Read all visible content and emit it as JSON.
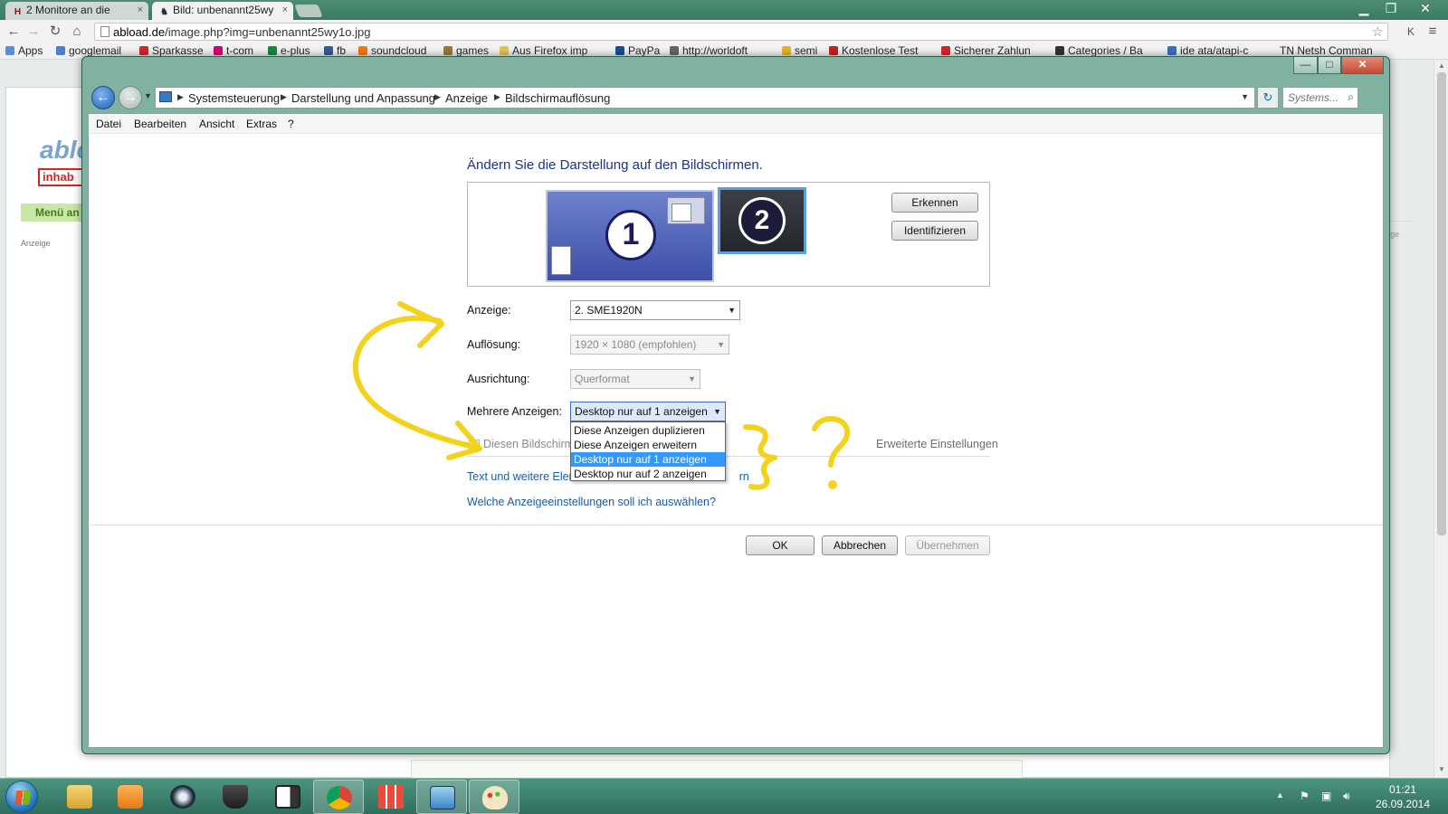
{
  "browser": {
    "tabs": [
      {
        "label": "2 Monitore an die"
      },
      {
        "label": "Bild: unbenannt25wy"
      }
    ],
    "url_domain": "abload.de",
    "url_path": "/image.php?img=unbenannt25wy1o.jpg",
    "bookmarks": [
      "Apps",
      "googlemail",
      "Sparkasse",
      "t-com",
      "e-plus",
      "fb",
      "soundcloud",
      "games",
      "Aus Firefox imp",
      "PayPa",
      "http://worldoft",
      "semi",
      "Kostenlose Test",
      "Sicherer Zahlun",
      "Categories / Ba",
      "ide ata/atapi-c",
      "TN Netsh Comman"
    ]
  },
  "page_behind": {
    "logo": "ablo",
    "inhab": "inhab",
    "menu": "Menü an",
    "anzeige": "Anzeige",
    "right_text": "ige"
  },
  "window": {
    "breadcrumb": [
      "Systemsteuerung",
      "Darstellung und Anpassung",
      "Anzeige",
      "Bildschirmauflösung"
    ],
    "search_placeholder": "Systems...",
    "menu": [
      "Datei",
      "Bearbeiten",
      "Ansicht",
      "Extras",
      "?"
    ],
    "heading": "Ändern Sie die Darstellung auf den Bildschirmen.",
    "monitors": [
      "1",
      "2"
    ],
    "buttons": {
      "detect": "Erkennen",
      "identify": "Identifizieren",
      "ok": "OK",
      "cancel": "Abbrechen",
      "apply": "Übernehmen"
    },
    "fields": {
      "display_label": "Anzeige:",
      "display_value": "2. SME1920N",
      "resolution_label": "Auflösung:",
      "resolution_value": "1920 × 1080 (empfohlen)",
      "orientation_label": "Ausrichtung:",
      "orientation_value": "Querformat",
      "multi_label": "Mehrere Anzeigen:",
      "multi_value": "Desktop nur auf 1 anzeigen"
    },
    "multi_options": [
      "Diese Anzeigen duplizieren",
      "Diese Anzeigen erweitern",
      "Desktop nur auf 1 anzeigen",
      "Desktop nur auf 2 anzeigen"
    ],
    "checkbox_label": "Diesen Bildschirm",
    "advanced_link": "Erweiterte Einstellungen",
    "link_text_size": "Text und weitere Eler",
    "link_text_size_tail": "rn",
    "link_which": "Welche Anzeigeeinstellungen soll ich auswählen?"
  },
  "taskbar": {
    "time": "01:21",
    "date": "26.09.2014"
  },
  "colors": {
    "accent": "#3399ff",
    "link": "#1a5ba6",
    "heading": "#1e3287",
    "annotation": "#f3d21b"
  }
}
